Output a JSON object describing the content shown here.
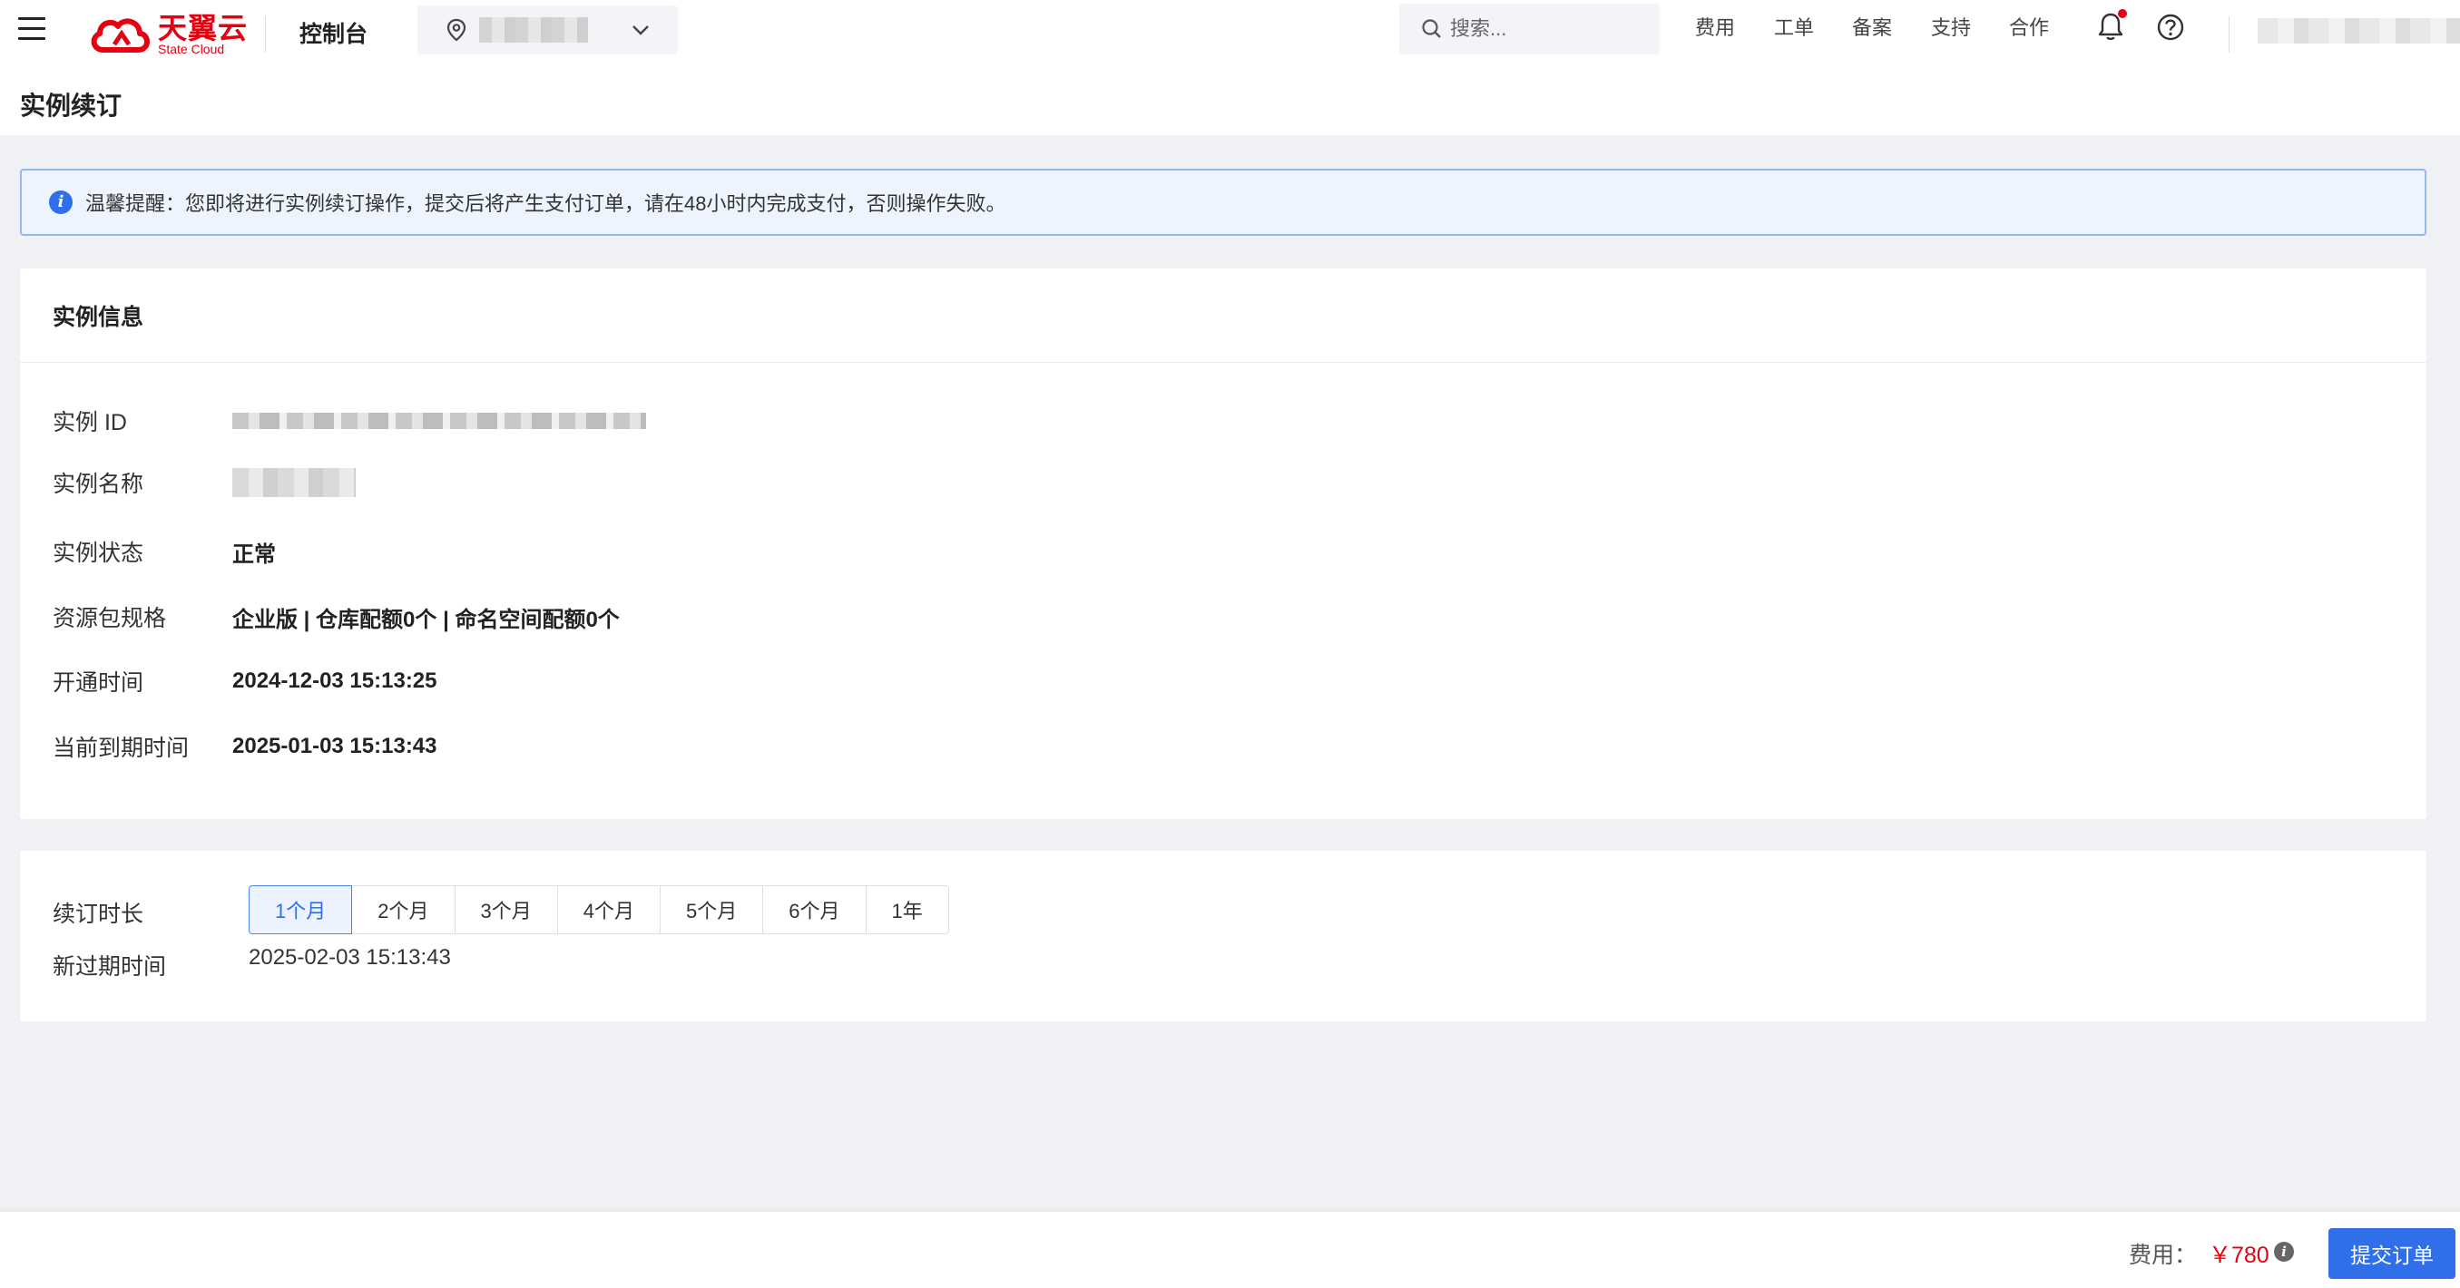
{
  "header": {
    "logo_cn": "天翼云",
    "logo_en": "State Cloud",
    "console": "控制台",
    "search_placeholder": "搜索...",
    "nav": [
      "费用",
      "工单",
      "备案",
      "支持",
      "合作"
    ]
  },
  "page": {
    "title": "实例续订"
  },
  "alert": {
    "text": "温馨提醒：您即将进行实例续订操作，提交后将产生支付订单，请在48小时内完成支付，否则操作失败。"
  },
  "instance": {
    "section_title": "实例信息",
    "rows": [
      {
        "label": "实例 ID",
        "value": ""
      },
      {
        "label": "实例名称",
        "value": ""
      },
      {
        "label": "实例状态",
        "value": "正常"
      },
      {
        "label": "资源包规格",
        "value": "企业版 | 仓库配额0个 | 命名空间配额0个"
      },
      {
        "label": "开通时间",
        "value": "2024-12-03 15:13:25"
      },
      {
        "label": "当前到期时间",
        "value": "2025-01-03 15:13:43"
      }
    ]
  },
  "renew": {
    "duration_label": "续订时长",
    "durations": [
      "1个月",
      "2个月",
      "3个月",
      "4个月",
      "5个月",
      "6个月",
      "1年"
    ],
    "selected": "1个月",
    "new_expire_label": "新过期时间",
    "new_expire_value": "2025-02-03 15:13:43"
  },
  "footer": {
    "fee_label": "费用：",
    "fee_value": "￥780",
    "submit": "提交订单"
  },
  "colors": {
    "primary": "#2f6fea",
    "brand_red": "#e60012",
    "alert_bg": "#eef4fe"
  }
}
